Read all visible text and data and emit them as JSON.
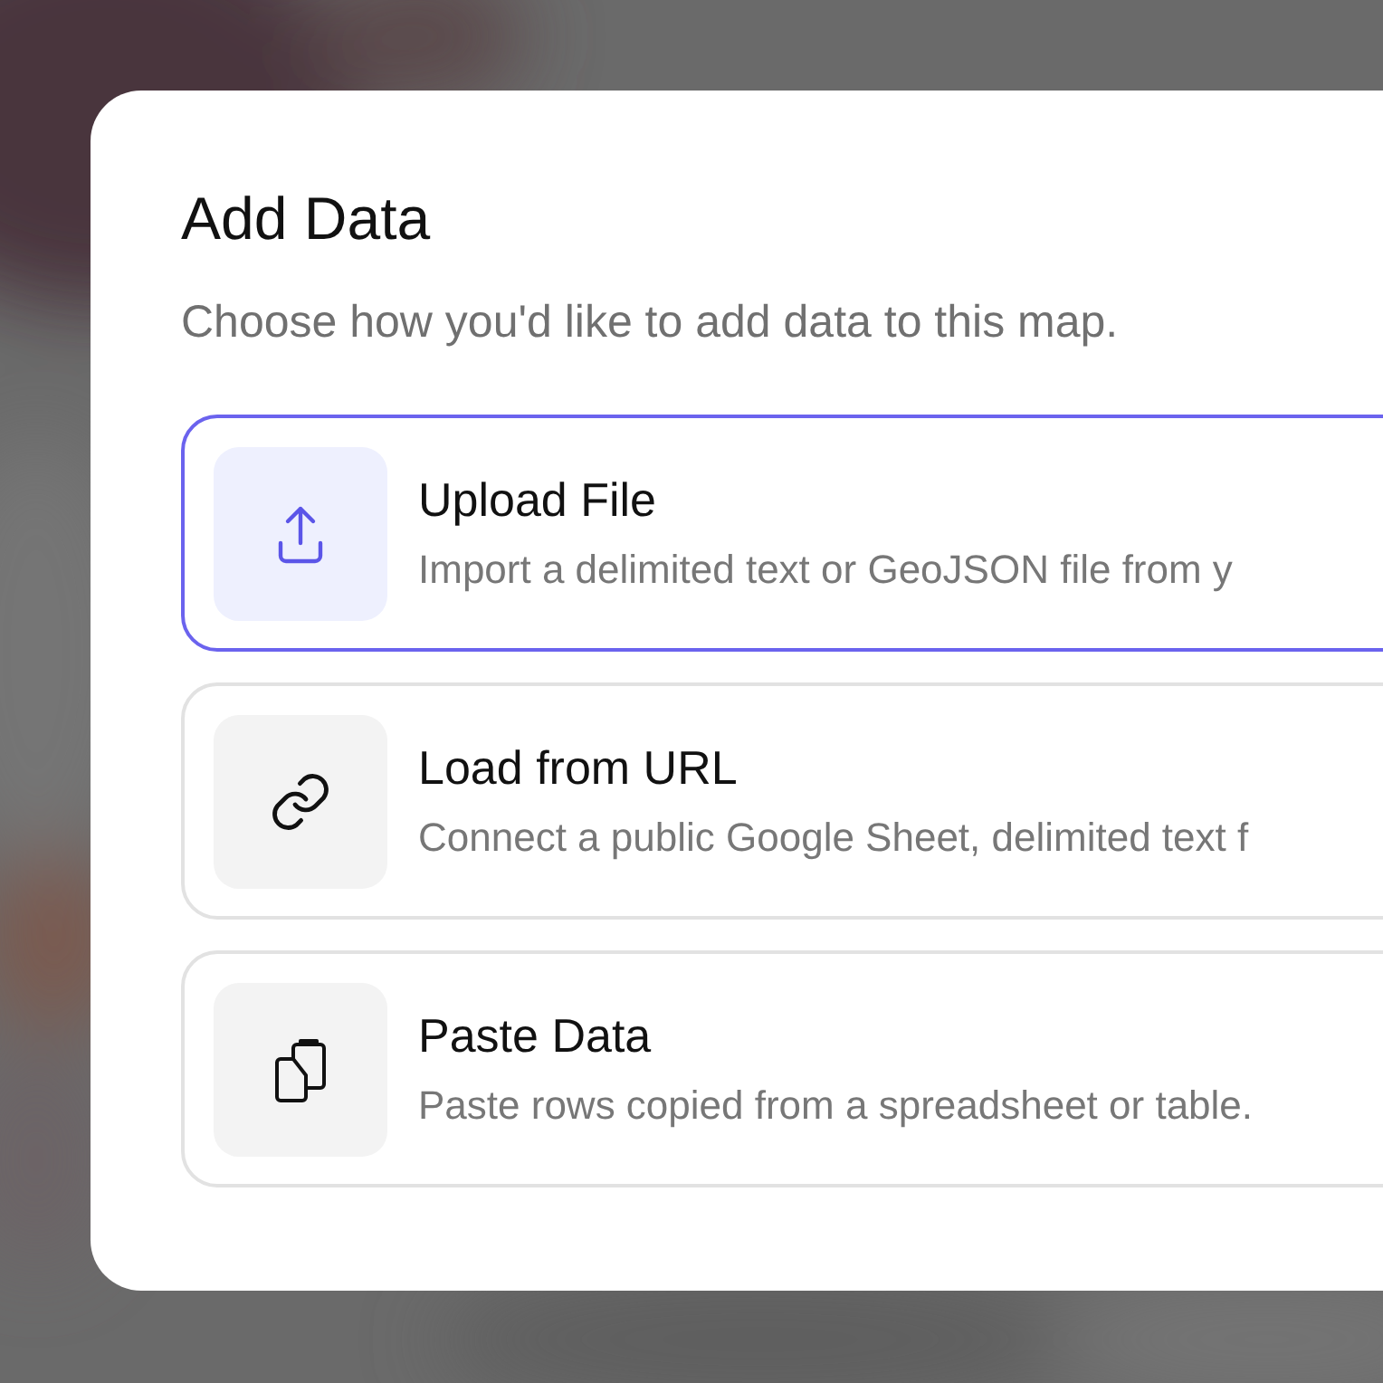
{
  "dialog": {
    "title": "Add Data",
    "subtitle": "Choose how you'd like to add data to this map.",
    "options": [
      {
        "kind": "upload",
        "title": "Upload File",
        "description": "Import a delimited text or GeoJSON file from y",
        "selected": true
      },
      {
        "kind": "link",
        "title": "Load from URL",
        "description": "Connect a public Google Sheet, delimited text f",
        "selected": false
      },
      {
        "kind": "paste",
        "title": "Paste Data",
        "description": "Paste rows copied from a spreadsheet or table.",
        "selected": false
      }
    ]
  }
}
